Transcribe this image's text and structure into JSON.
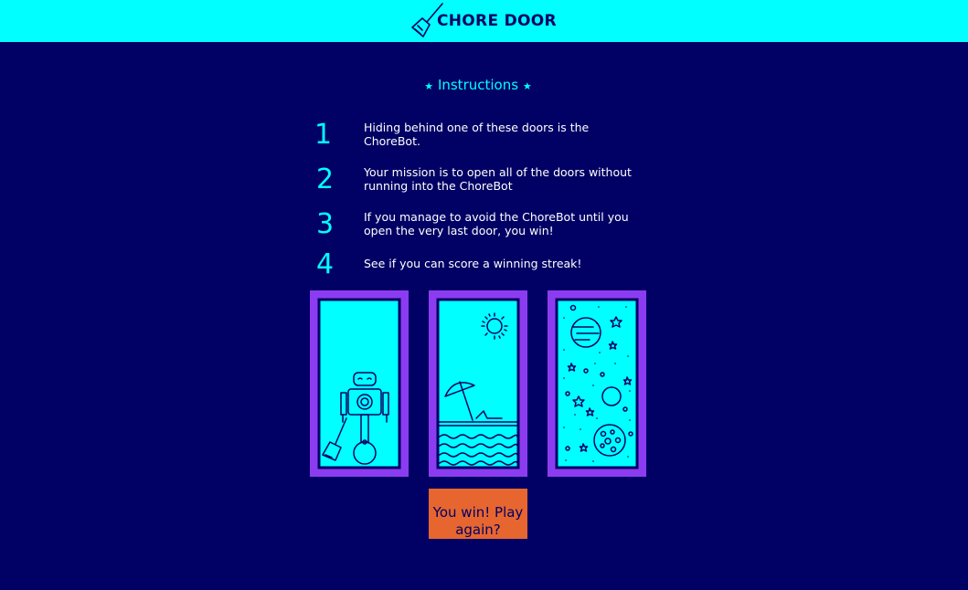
{
  "header": {
    "logo_icon": "broom-icon",
    "title": "CHORE DOOR",
    "background": "#00ffff"
  },
  "instructions": {
    "title": "Instructions",
    "star_icon": "star-icon",
    "steps": [
      {
        "number": "1",
        "text": "Hiding behind one of these doors is the ChoreBot."
      },
      {
        "number": "2",
        "text": "Your mission is to open all of the doors without running into the ChoreBot"
      },
      {
        "number": "3",
        "text": "If you manage to avoid the ChoreBot until you open the very last door, you win!"
      },
      {
        "number": "4",
        "text": "See if you can score a winning streak!"
      }
    ]
  },
  "doors": [
    {
      "content": "robot-icon",
      "state": "open"
    },
    {
      "content": "beach-icon",
      "state": "open"
    },
    {
      "content": "space-icon",
      "state": "open"
    }
  ],
  "start_button": {
    "label": "You win! Play again?",
    "color": "#e7662f"
  },
  "colors": {
    "background": "#010165",
    "accent": "#00ffff",
    "door_frame": "#8c3cf0",
    "text": "#ffffff"
  }
}
